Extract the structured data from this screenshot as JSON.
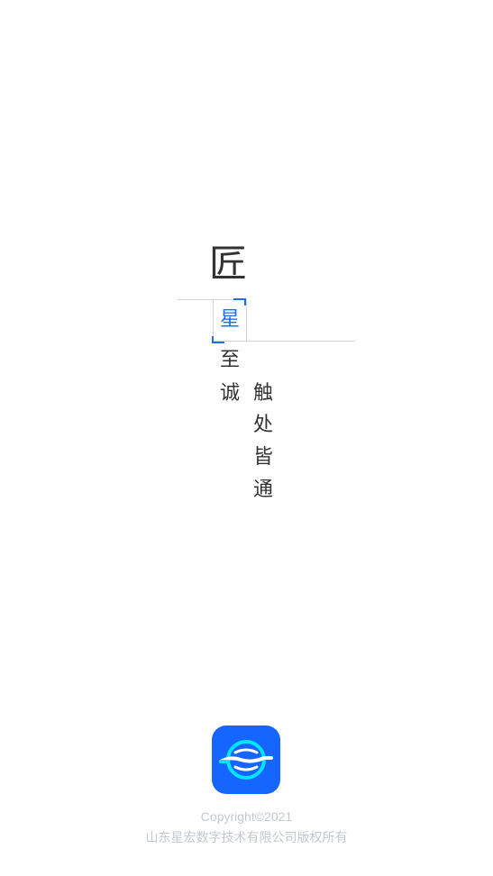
{
  "slogan": {
    "char_jiang": "匠",
    "char_xing": "星",
    "char_zhi": "至",
    "char_cheng": "诚",
    "char_chu": "触",
    "char_chu2": "处",
    "char_jie": "皆",
    "char_tong": "通"
  },
  "footer": {
    "copyright": "Copyright©2021",
    "company": "山东星宏数字技术有限公司版权所有"
  },
  "colors": {
    "accent": "#1e6ff0",
    "logo_bg": "#1565ff",
    "logo_ring": "#00e5ff",
    "text": "#333333",
    "footer_text": "#c4c8d0"
  },
  "icons": {
    "app_logo": "orbit-ring-logo-icon"
  }
}
